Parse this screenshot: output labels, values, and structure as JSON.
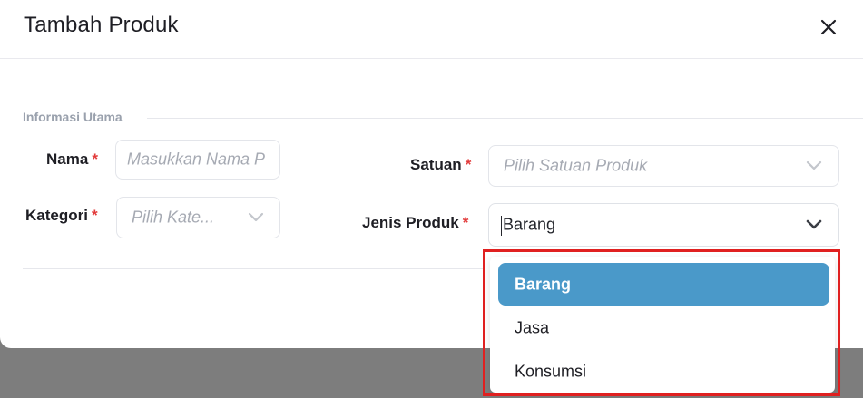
{
  "modal": {
    "title": "Tambah Produk"
  },
  "section": {
    "label": "Informasi Utama"
  },
  "fields": {
    "nama": {
      "label": "Nama",
      "required": "*",
      "placeholder": "Masukkan Nama P"
    },
    "kategori": {
      "label": "Kategori",
      "required": "*",
      "placeholder": "Pilih Kate..."
    },
    "satuan": {
      "label": "Satuan",
      "required": "*",
      "placeholder": "Pilih Satuan Produk"
    },
    "jenis_produk": {
      "label": "Jenis Produk",
      "required": "*",
      "value": "Barang"
    }
  },
  "dropdown": {
    "options": [
      "Barang",
      "Jasa",
      "Konsumsi"
    ],
    "selected": "Barang"
  },
  "colors": {
    "accent": "#4a99c9",
    "required": "#e23b3b",
    "highlight": "#e02020"
  },
  "icons": {
    "close": "close-icon",
    "chevron": "chevron-down-icon"
  }
}
